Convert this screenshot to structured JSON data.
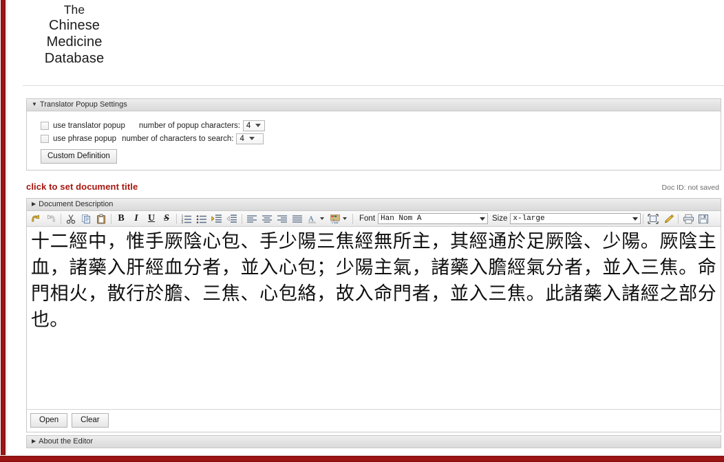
{
  "brand": {
    "line1": "The",
    "line2": "Chinese",
    "line3": "Medicine",
    "line4": "Database"
  },
  "settings_panel": {
    "title": "Translator Popup Settings",
    "collapse_glyph": "▼",
    "options": [
      {
        "checkbox_label": "use translator popup",
        "select_label": "number of popup characters:",
        "select_value": "4"
      },
      {
        "checkbox_label": "use phrase popup",
        "select_label": "number of characters to search:",
        "select_value": "4"
      }
    ],
    "custom_definition_label": "Custom Definition"
  },
  "document": {
    "title_placeholder": "click to set document title",
    "doc_id_label": "Doc ID: not saved"
  },
  "description_panel": {
    "title": "Document Description",
    "expand_glyph": "▶"
  },
  "toolbar": {
    "font_label": "Font",
    "font_value": "Han Nom A",
    "size_label": "Size",
    "size_value": "x-large",
    "bold_label": "B",
    "italic_label": "I",
    "underline_label": "U",
    "strike_label": "S",
    "icons": [
      "undo-icon",
      "redo-icon",
      "cut-icon",
      "copy-icon",
      "paste-icon",
      "numbered-list-icon",
      "bulleted-list-icon",
      "indent-icon",
      "outdent-icon",
      "align-left-icon",
      "align-center-icon",
      "align-right-icon",
      "align-justify-icon",
      "text-color-icon",
      "highlight-color-icon",
      "fullscreen-icon",
      "highlighter-pen-icon",
      "print-icon",
      "save-icon"
    ]
  },
  "editor": {
    "body_text": "十二經中，惟手厥陰心包、手少陽三焦經無所主，其經通於足厥陰、少陽。厥陰主血，諸藥入肝經血分者，並入心包；少陽主氣，諸藥入膽經氣分者，並入三焦。命門相火，散行於膽、三焦、心包絡，故入命門者，並入三焦。此諸藥入諸經之部分也。",
    "open_label": "Open",
    "clear_label": "Clear"
  },
  "about_panel": {
    "title": "About the Editor",
    "expand_glyph": "▶"
  },
  "colors": {
    "brand_red": "#9e1515",
    "title_red": "#a5160f",
    "panel_bg": "#e3e3e3",
    "border": "#c8c8c8"
  }
}
